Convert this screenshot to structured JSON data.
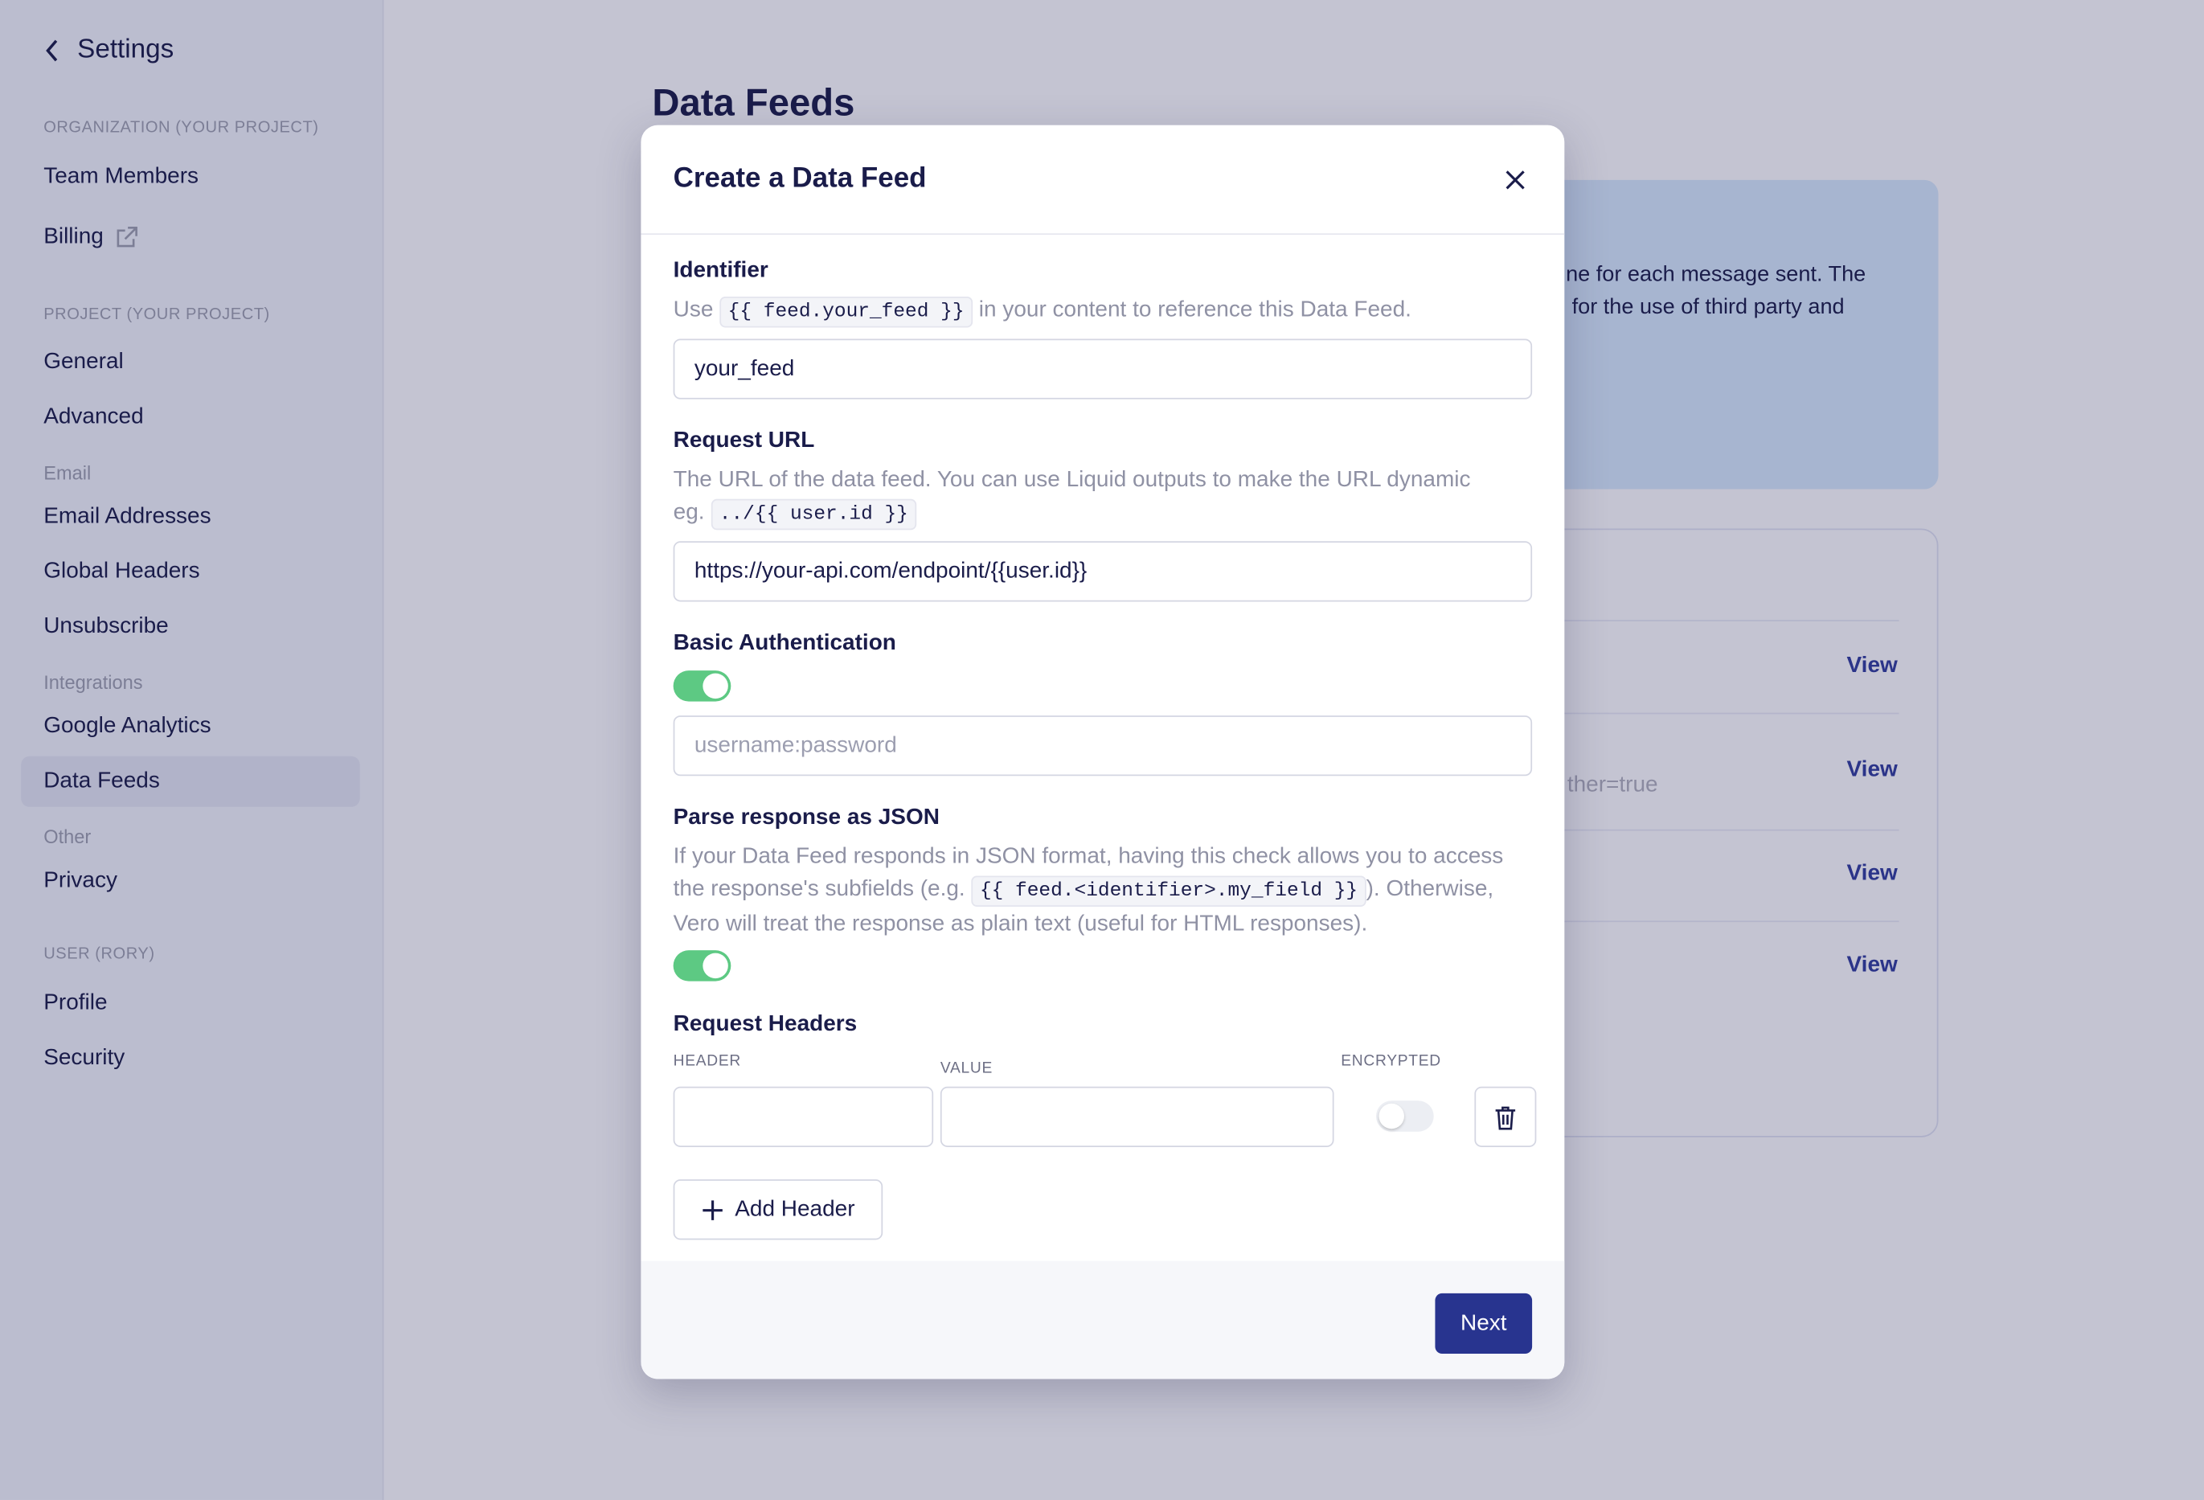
{
  "sidebar": {
    "back_label": "Settings",
    "sections": [
      {
        "heading": "ORGANIZATION (YOUR PROJECT)",
        "items": [
          "Team Members",
          "Billing"
        ]
      },
      {
        "heading": "PROJECT (YOUR PROJECT)",
        "items": [
          "General",
          "Advanced"
        ]
      }
    ],
    "email_heading": "Email",
    "email_items": [
      "Email Addresses",
      "Global Headers",
      "Unsubscribe"
    ],
    "integrations_heading": "Integrations",
    "integrations_items": [
      "Google Analytics",
      "Data Feeds"
    ],
    "other_heading": "Other",
    "other_items": [
      "Privacy"
    ],
    "user_heading": "USER (RORY)",
    "user_items": [
      "Profile",
      "Security"
    ],
    "active": "Data Feeds"
  },
  "page": {
    "title": "Data Feeds",
    "info_text_1": "ne for each message sent. The",
    "info_text_2": " for the use of third party and",
    "list_partial_text": "ther=true",
    "view_label": "View"
  },
  "modal": {
    "title": "Create a Data Feed",
    "identifier": {
      "label": "Identifier",
      "help_pre": "Use ",
      "help_code": "{{ feed.your_feed }}",
      "help_post": " in your content to reference this Data Feed.",
      "value": "your_feed"
    },
    "request_url": {
      "label": "Request URL",
      "help": "The URL of the data feed. You can use Liquid outputs to make the URL dynamic",
      "help_eg": "eg. ",
      "help_code": "../{{ user.id }}",
      "value": "https://your-api.com/endpoint/{{user.id}}"
    },
    "basic_auth": {
      "label": "Basic Authentication",
      "enabled": true,
      "placeholder": "username:password"
    },
    "parse_json": {
      "label": "Parse response as JSON",
      "help_1": "If your Data Feed responds in JSON format, having this check allows you to access",
      "help_2_pre": "the response's subfields (e.g. ",
      "help_code": "{{ feed.<identifier>.my_field }}",
      "help_2_post": "). Otherwise,",
      "help_3": "Vero will treat the response as plain text (useful for HTML responses).",
      "enabled": true
    },
    "headers": {
      "label": "Request Headers",
      "col_header": "HEADER",
      "col_value": "VALUE",
      "col_encrypted": "ENCRYPTED",
      "encrypted": false,
      "add_label": "Add Header"
    },
    "next_label": "Next"
  },
  "colors": {
    "accent": "#28348f",
    "toggle_on": "#5dc983",
    "link": "#2b3489"
  }
}
